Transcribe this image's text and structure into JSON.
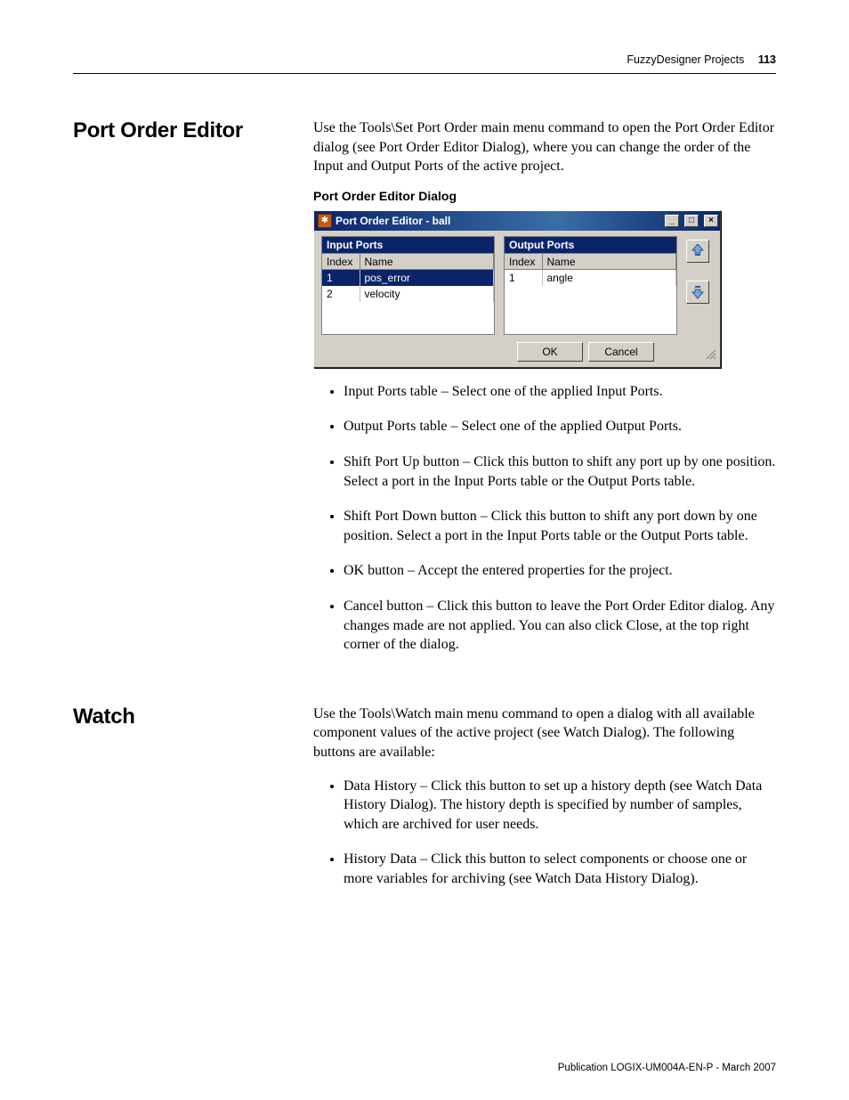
{
  "header": {
    "chapter": "FuzzyDesigner Projects",
    "pageno": "113"
  },
  "section1": {
    "heading": "Port Order Editor",
    "intro": "Use the Tools\\Set Port Order main menu command to open the Port Order Editor dialog (see Port Order Editor Dialog), where you can change the order of the Input and Output Ports of the active project.",
    "caption": "Port Order Editor Dialog",
    "dialog": {
      "title": "Port Order Editor - ball",
      "inputPortsLabel": "Input Ports",
      "outputPortsLabel": "Output Ports",
      "colIndex": "Index",
      "colName": "Name",
      "inputPorts": [
        {
          "index": "1",
          "name": "pos_error",
          "selected": true
        },
        {
          "index": "2",
          "name": "velocity",
          "selected": false
        }
      ],
      "outputPorts": [
        {
          "index": "1",
          "name": "angle",
          "selected": false
        }
      ],
      "ok": "OK",
      "cancel": "Cancel"
    },
    "bullets": [
      "Input Ports table – Select one of the applied Input Ports.",
      "Output Ports table – Select one of the applied Output Ports.",
      "Shift Port Up button – Click this button to shift any port up by one position. Select a port in the Input Ports table or the Output Ports table.",
      "Shift Port Down button – Click this button to shift any port down by one position. Select a port in the Input Ports table or the Output Ports table.",
      "OK button – Accept the entered properties for the project.",
      "Cancel button – Click this button to leave the Port Order Editor dialog. Any changes made are not applied. You can also click Close, at the top right corner of the dialog."
    ]
  },
  "section2": {
    "heading": "Watch",
    "intro": "Use the Tools\\Watch main menu command to open a dialog with all available component values of the active project (see Watch Dialog). The following buttons are available:",
    "bullets": [
      "Data History – Click this button to set up a history depth (see Watch Data History Dialog). The history depth is specified by number of samples, which are archived for user needs.",
      "History Data – Click this button to select components or choose one or more variables for archiving (see Watch Data History Dialog)."
    ]
  },
  "footer": "Publication LOGIX-UM004A-EN-P - March 2007"
}
